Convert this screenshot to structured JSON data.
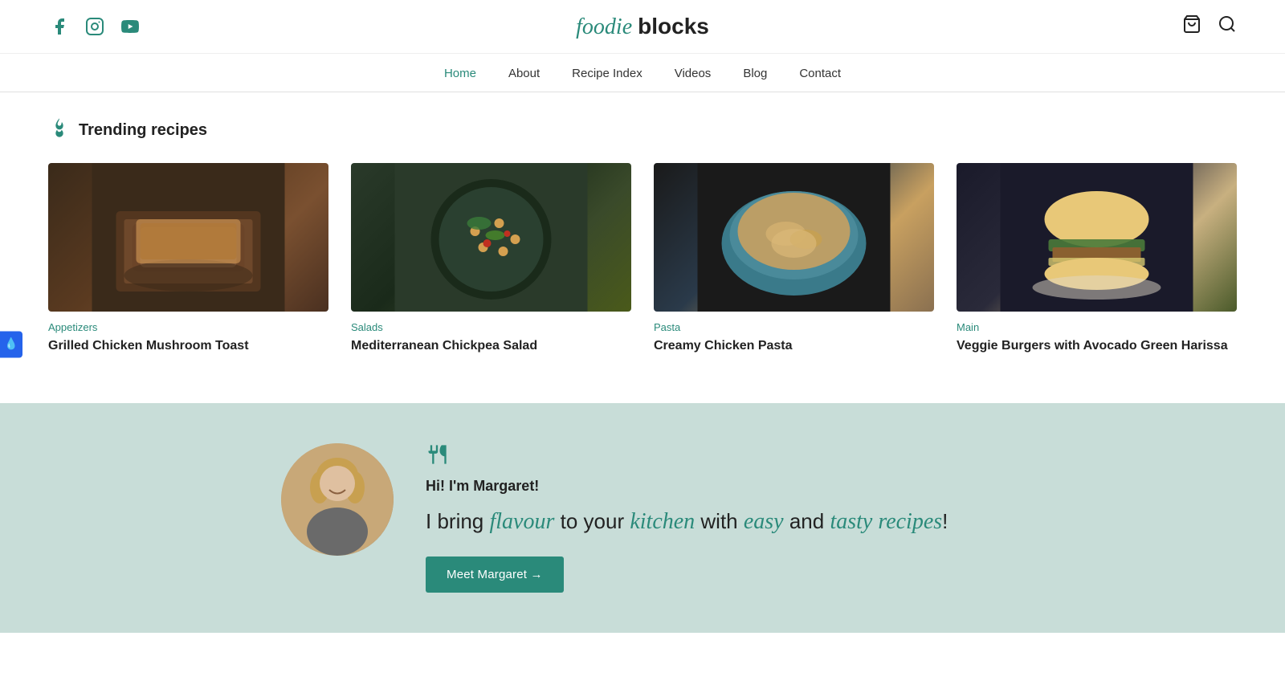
{
  "header": {
    "logo": {
      "foodie": "foodie",
      "blocks": "blocks"
    },
    "social_icons": [
      {
        "name": "facebook-icon",
        "symbol": "f"
      },
      {
        "name": "instagram-icon",
        "symbol": "◻"
      },
      {
        "name": "youtube-icon",
        "symbol": "▶"
      }
    ],
    "cart_icon": "🛒",
    "search_icon": "🔍"
  },
  "nav": {
    "items": [
      {
        "label": "Home",
        "active": true
      },
      {
        "label": "About",
        "active": false
      },
      {
        "label": "Recipe Index",
        "active": false
      },
      {
        "label": "Videos",
        "active": false
      },
      {
        "label": "Blog",
        "active": false
      },
      {
        "label": "Contact",
        "active": false
      }
    ]
  },
  "sidebar": {
    "icon": "💧"
  },
  "trending": {
    "section_title": "Trending recipes",
    "recipes": [
      {
        "category": "Appetizers",
        "title": "Grilled Chicken Mushroom Toast",
        "image_class": "food-img-1"
      },
      {
        "category": "Salads",
        "title": "Mediterranean Chickpea Salad",
        "image_class": "food-img-2"
      },
      {
        "category": "Pasta",
        "title": "Creamy Chicken Pasta",
        "image_class": "food-img-3"
      },
      {
        "category": "Main",
        "title": "Veggie Burgers with Avocado Green Harissa",
        "image_class": "food-img-4"
      }
    ]
  },
  "about": {
    "hi_text": "Hi! I'm Margaret!",
    "tagline_parts": {
      "intro": "I bring ",
      "word1": "flavour",
      "middle1": " to your ",
      "word2": "kitchen",
      "middle2": " with ",
      "word3": "easy",
      "middle3": " and ",
      "word4": "tasty recipes",
      "end": "!"
    },
    "cta_label": "Meet Margaret →"
  }
}
